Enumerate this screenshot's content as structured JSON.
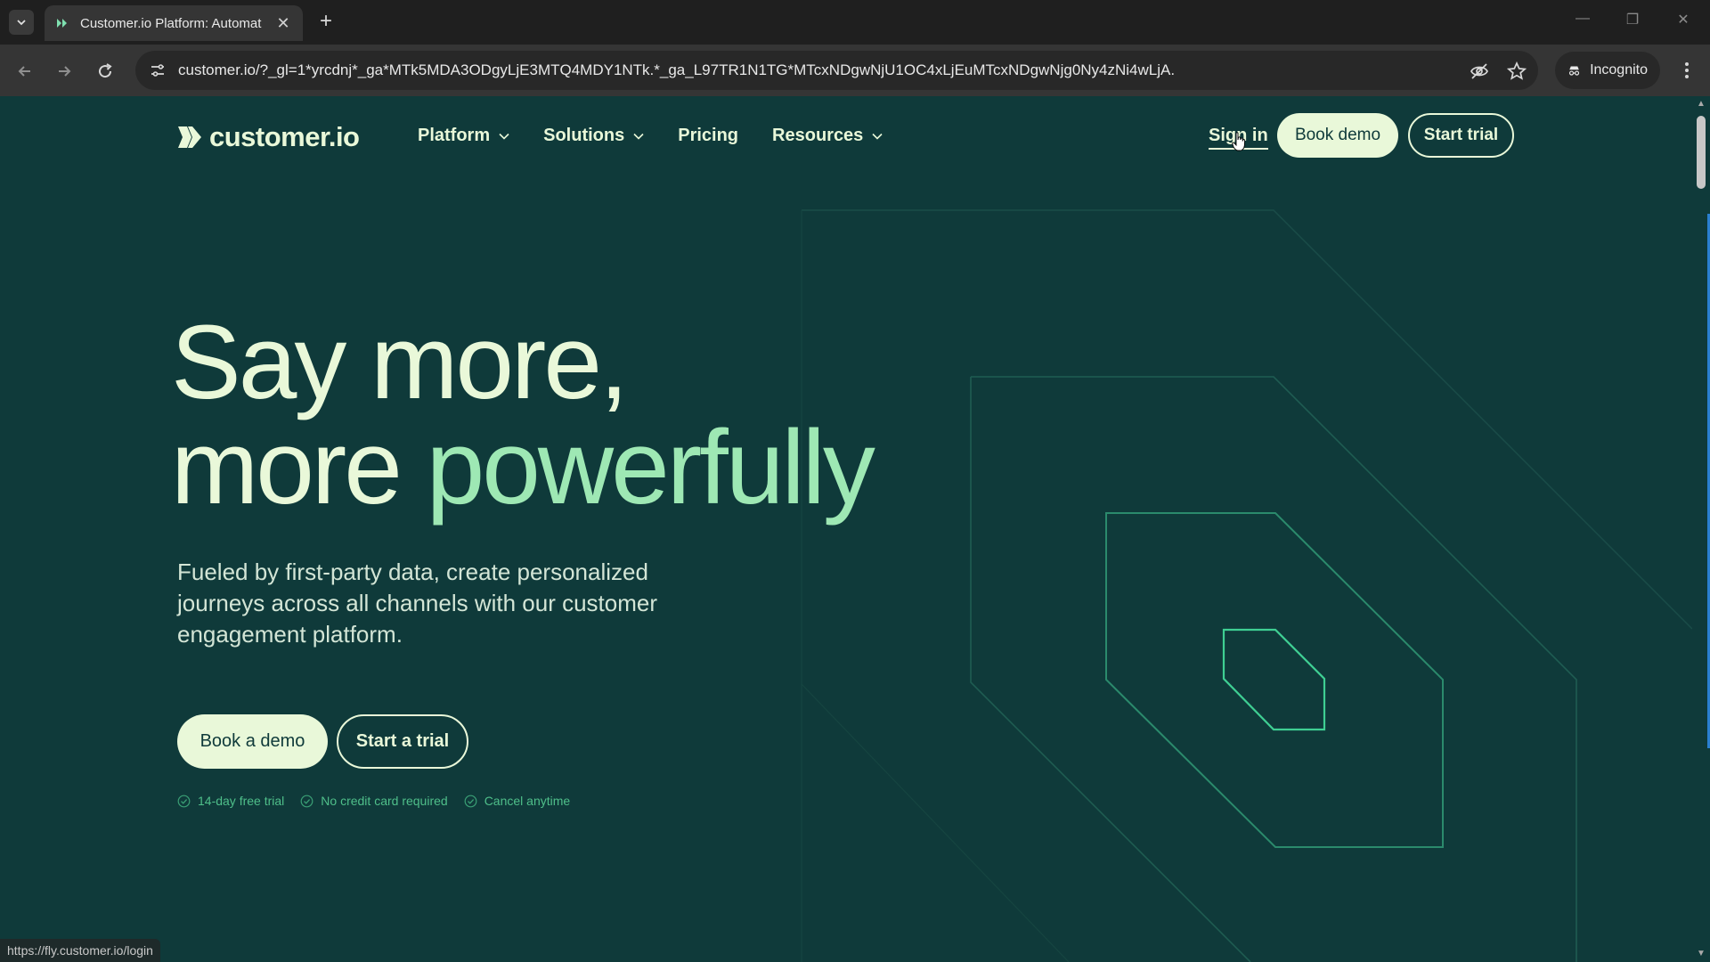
{
  "browser": {
    "tab_title": "Customer.io Platform: Automat",
    "url": "customer.io/?_gl=1*yrcdnj*_ga*MTk5MDA3ODgyLjE3MTQ4MDY1NTk.*_ga_L97TR1N1TG*MTcxNDgwNjU1OC4xLjEuMTcxNDgwNjg0Ny4zNi4wLjA.",
    "incognito_label": "Incognito",
    "status_url": "https://fly.customer.io/login"
  },
  "header": {
    "logo_text": "customer.io",
    "nav": [
      {
        "label": "Platform"
      },
      {
        "label": "Solutions"
      },
      {
        "label": "Pricing"
      },
      {
        "label": "Resources"
      }
    ],
    "sign_in": "Sign in",
    "book_demo": "Book demo",
    "start_trial": "Start trial"
  },
  "hero": {
    "title_line1": "Say more,",
    "title_line2_a": "more ",
    "title_line2_b": "powerfully",
    "subtitle": "Fueled by first-party data, create personalized journeys across all channels with our customer engagement platform.",
    "cta_demo": "Book a demo",
    "cta_trial": "Start a trial",
    "perks": [
      "14-day free trial",
      "No credit card required",
      "Cancel anytime"
    ]
  },
  "colors": {
    "page_bg": "#0f3a3a",
    "cream": "#e9f8d9",
    "accent_green": "#4fbf8a"
  }
}
